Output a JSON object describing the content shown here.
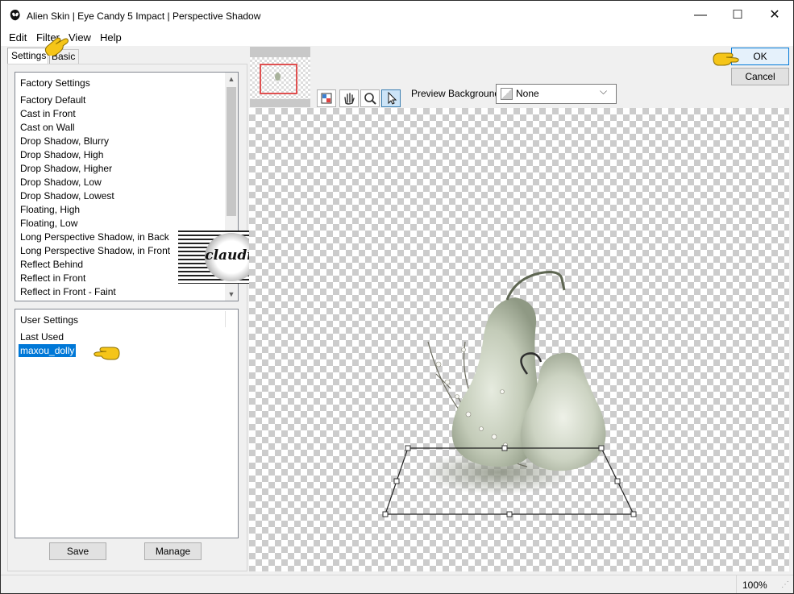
{
  "window": {
    "title": "Alien Skin | Eye Candy 5 Impact | Perspective Shadow",
    "minimize": "—",
    "maximize": "☐",
    "close": "✕"
  },
  "menu": [
    "Edit",
    "Filter",
    "View",
    "Help"
  ],
  "tabs": {
    "settings": "Settings",
    "basic": "Basic"
  },
  "factory_settings": {
    "header": "Factory Settings",
    "items": [
      "Factory Default",
      "Cast in Front",
      "Cast on Wall",
      "Drop Shadow, Blurry",
      "Drop Shadow, High",
      "Drop Shadow, Higher",
      "Drop Shadow, Low",
      "Drop Shadow, Lowest",
      "Floating, High",
      "Floating, Low",
      "Long Perspective Shadow, in Back",
      "Long Perspective Shadow, in Front",
      "Reflect Behind",
      "Reflect in Front",
      "Reflect in Front - Faint"
    ]
  },
  "user_settings": {
    "header": "User Settings",
    "items": [
      "Last Used",
      "maxou_dolly"
    ],
    "selected": "maxou_dolly"
  },
  "buttons": {
    "save": "Save",
    "manage": "Manage",
    "ok": "OK",
    "cancel": "Cancel"
  },
  "preview_background": {
    "label": "Preview Background:",
    "value": "None"
  },
  "watermark": {
    "text": "claudia"
  },
  "status": {
    "zoom": "100%"
  },
  "colors": {
    "selection": "#0078d7",
    "hand_pointer": "#f5c518",
    "thumbnail_frame": "#e05050"
  }
}
